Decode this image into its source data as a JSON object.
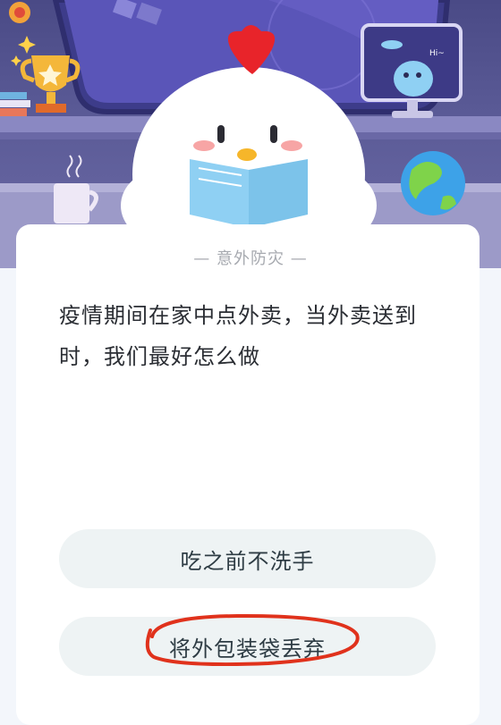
{
  "quiz": {
    "category": "— 意外防灾 —",
    "question": "疫情期间在家中点外卖，当外卖送到时，我们最好怎么做",
    "options": [
      {
        "label": "吃之前不洗手"
      },
      {
        "label": "将外包装袋丢弃"
      }
    ]
  },
  "scene": {
    "tv_text": "Hi~"
  },
  "colors": {
    "scene_bg": "#4a4a86",
    "card_bg": "#ffffff",
    "option_bg": "#eef3f4",
    "annotation_red": "#e0321c"
  }
}
